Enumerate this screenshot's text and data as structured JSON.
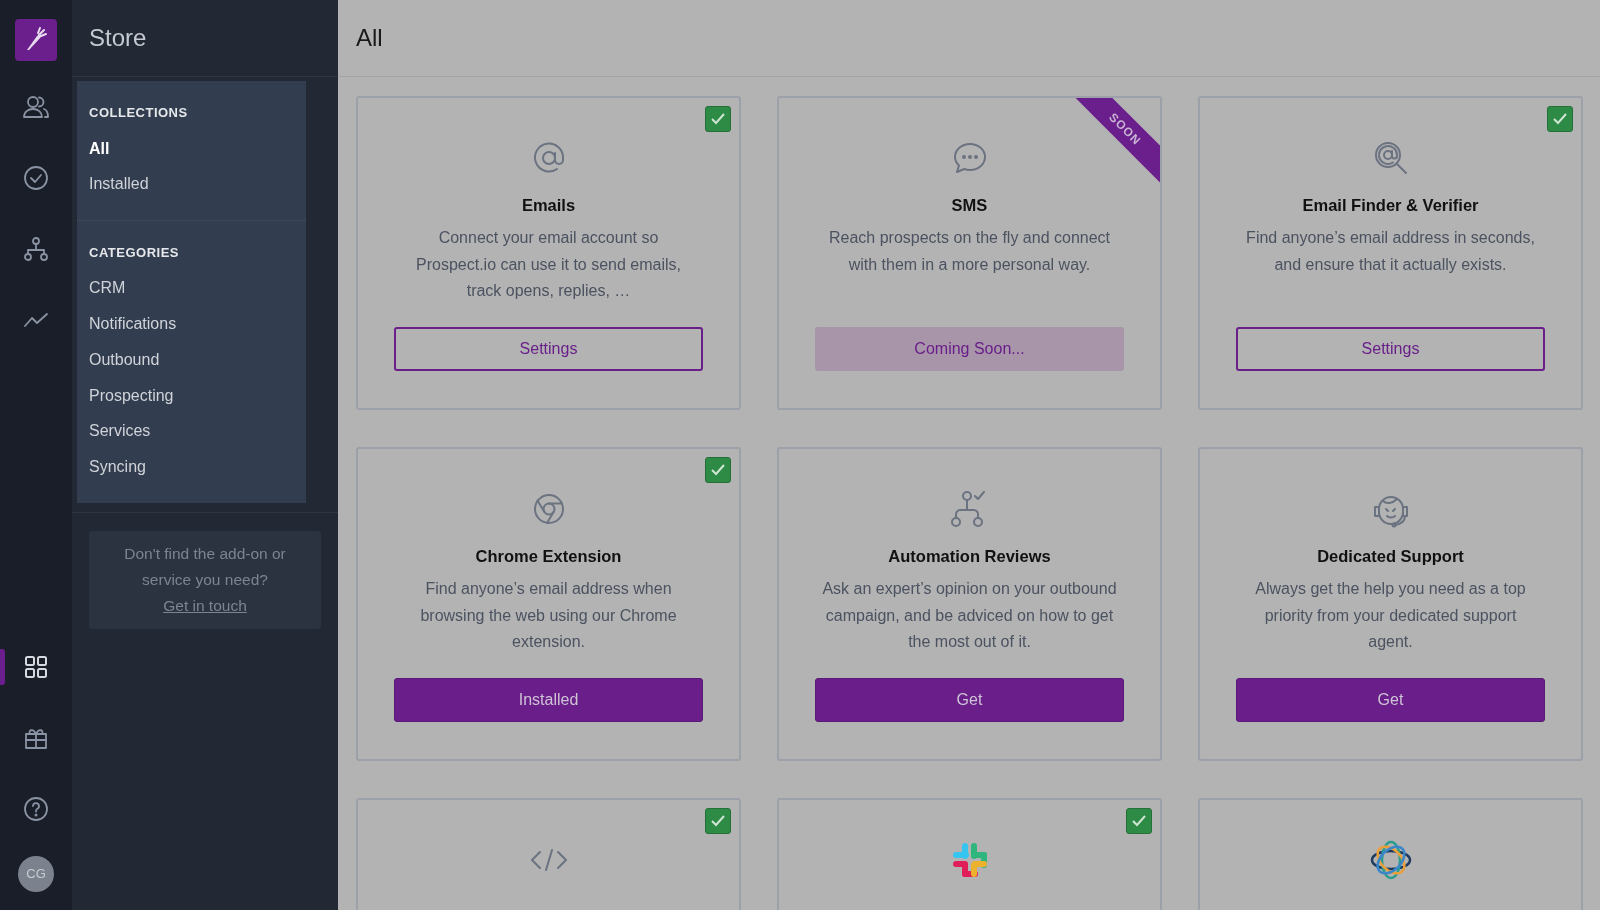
{
  "rail": {
    "avatar": "CG",
    "items": [
      {
        "selected": false
      },
      {
        "selected": false
      },
      {
        "selected": false
      },
      {
        "selected": false
      },
      {
        "selected": true
      },
      {
        "selected": false
      },
      {
        "selected": false
      }
    ]
  },
  "sidebar": {
    "title": "Store",
    "sections": [
      {
        "heading": "COLLECTIONS",
        "items": [
          {
            "label": "All",
            "selected": true
          },
          {
            "label": "Installed",
            "selected": false
          }
        ]
      },
      {
        "heading": "CATEGORIES",
        "items": [
          {
            "label": "CRM",
            "selected": false
          },
          {
            "label": "Notifications",
            "selected": false
          },
          {
            "label": "Outbound",
            "selected": false
          },
          {
            "label": "Prospecting",
            "selected": false
          },
          {
            "label": "Services",
            "selected": false
          },
          {
            "label": "Syncing",
            "selected": false
          }
        ]
      }
    ],
    "help": {
      "text": "Don't find the add-on or service you need?",
      "link": "Get in touch"
    }
  },
  "page_title": "All",
  "cards": [
    {
      "title": "Emails",
      "description": "Connect your email account so Prospect.io can use it to send emails, track opens, replies, …",
      "button": {
        "label": "Settings",
        "kind": "outline"
      },
      "installed": true
    },
    {
      "title": "SMS",
      "description": "Reach prospects on the fly and connect with them in a more personal way.",
      "button": {
        "label": "Coming Soon...",
        "kind": "disabled"
      },
      "installed": false,
      "ribbon": "SOON"
    },
    {
      "title": "Email Finder & Verifier",
      "description": "Find anyone’s email address in seconds, and ensure that it actually exists.",
      "button": {
        "label": "Settings",
        "kind": "outline"
      },
      "installed": true
    },
    {
      "title": "Chrome Extension",
      "description": "Find anyone’s email address when browsing the web using our Chrome extension.",
      "button": {
        "label": "Installed",
        "kind": "solid"
      },
      "installed": true
    },
    {
      "title": "Automation Reviews",
      "description": "Ask an expert’s opinion on your outbound campaign, and be adviced on how to get the most out of it.",
      "button": {
        "label": "Get",
        "kind": "solid"
      },
      "installed": false
    },
    {
      "title": "Dedicated Support",
      "description": "Always get the help you need as a top priority from your dedicated support agent.",
      "button": {
        "label": "Get",
        "kind": "solid"
      },
      "installed": false
    },
    {
      "installed": true
    },
    {
      "installed": true
    },
    {
      "installed": false
    }
  ]
}
